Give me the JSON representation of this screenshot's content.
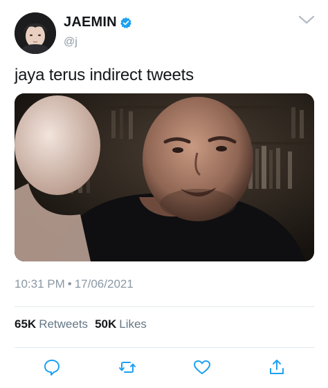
{
  "author": {
    "name": "JAEMIN",
    "handle": "@j",
    "verified": true
  },
  "tweet": {
    "text": "jaya terus indirect tweets"
  },
  "meta": {
    "time": "10:31 PM",
    "separator": "•",
    "date": "17/06/2021"
  },
  "stats": {
    "retweets_count": "65K",
    "retweets_label": "Retweets",
    "likes_count": "50K",
    "likes_label": "Likes"
  },
  "colors": {
    "text": "#14171a",
    "secondary": "#8b98a5",
    "verified": "#1da1f2",
    "divider": "#e1e8ed"
  },
  "icons": [
    "chevron-down-icon",
    "verified-badge-icon",
    "reply-icon",
    "retweet-icon",
    "like-icon",
    "share-icon"
  ]
}
